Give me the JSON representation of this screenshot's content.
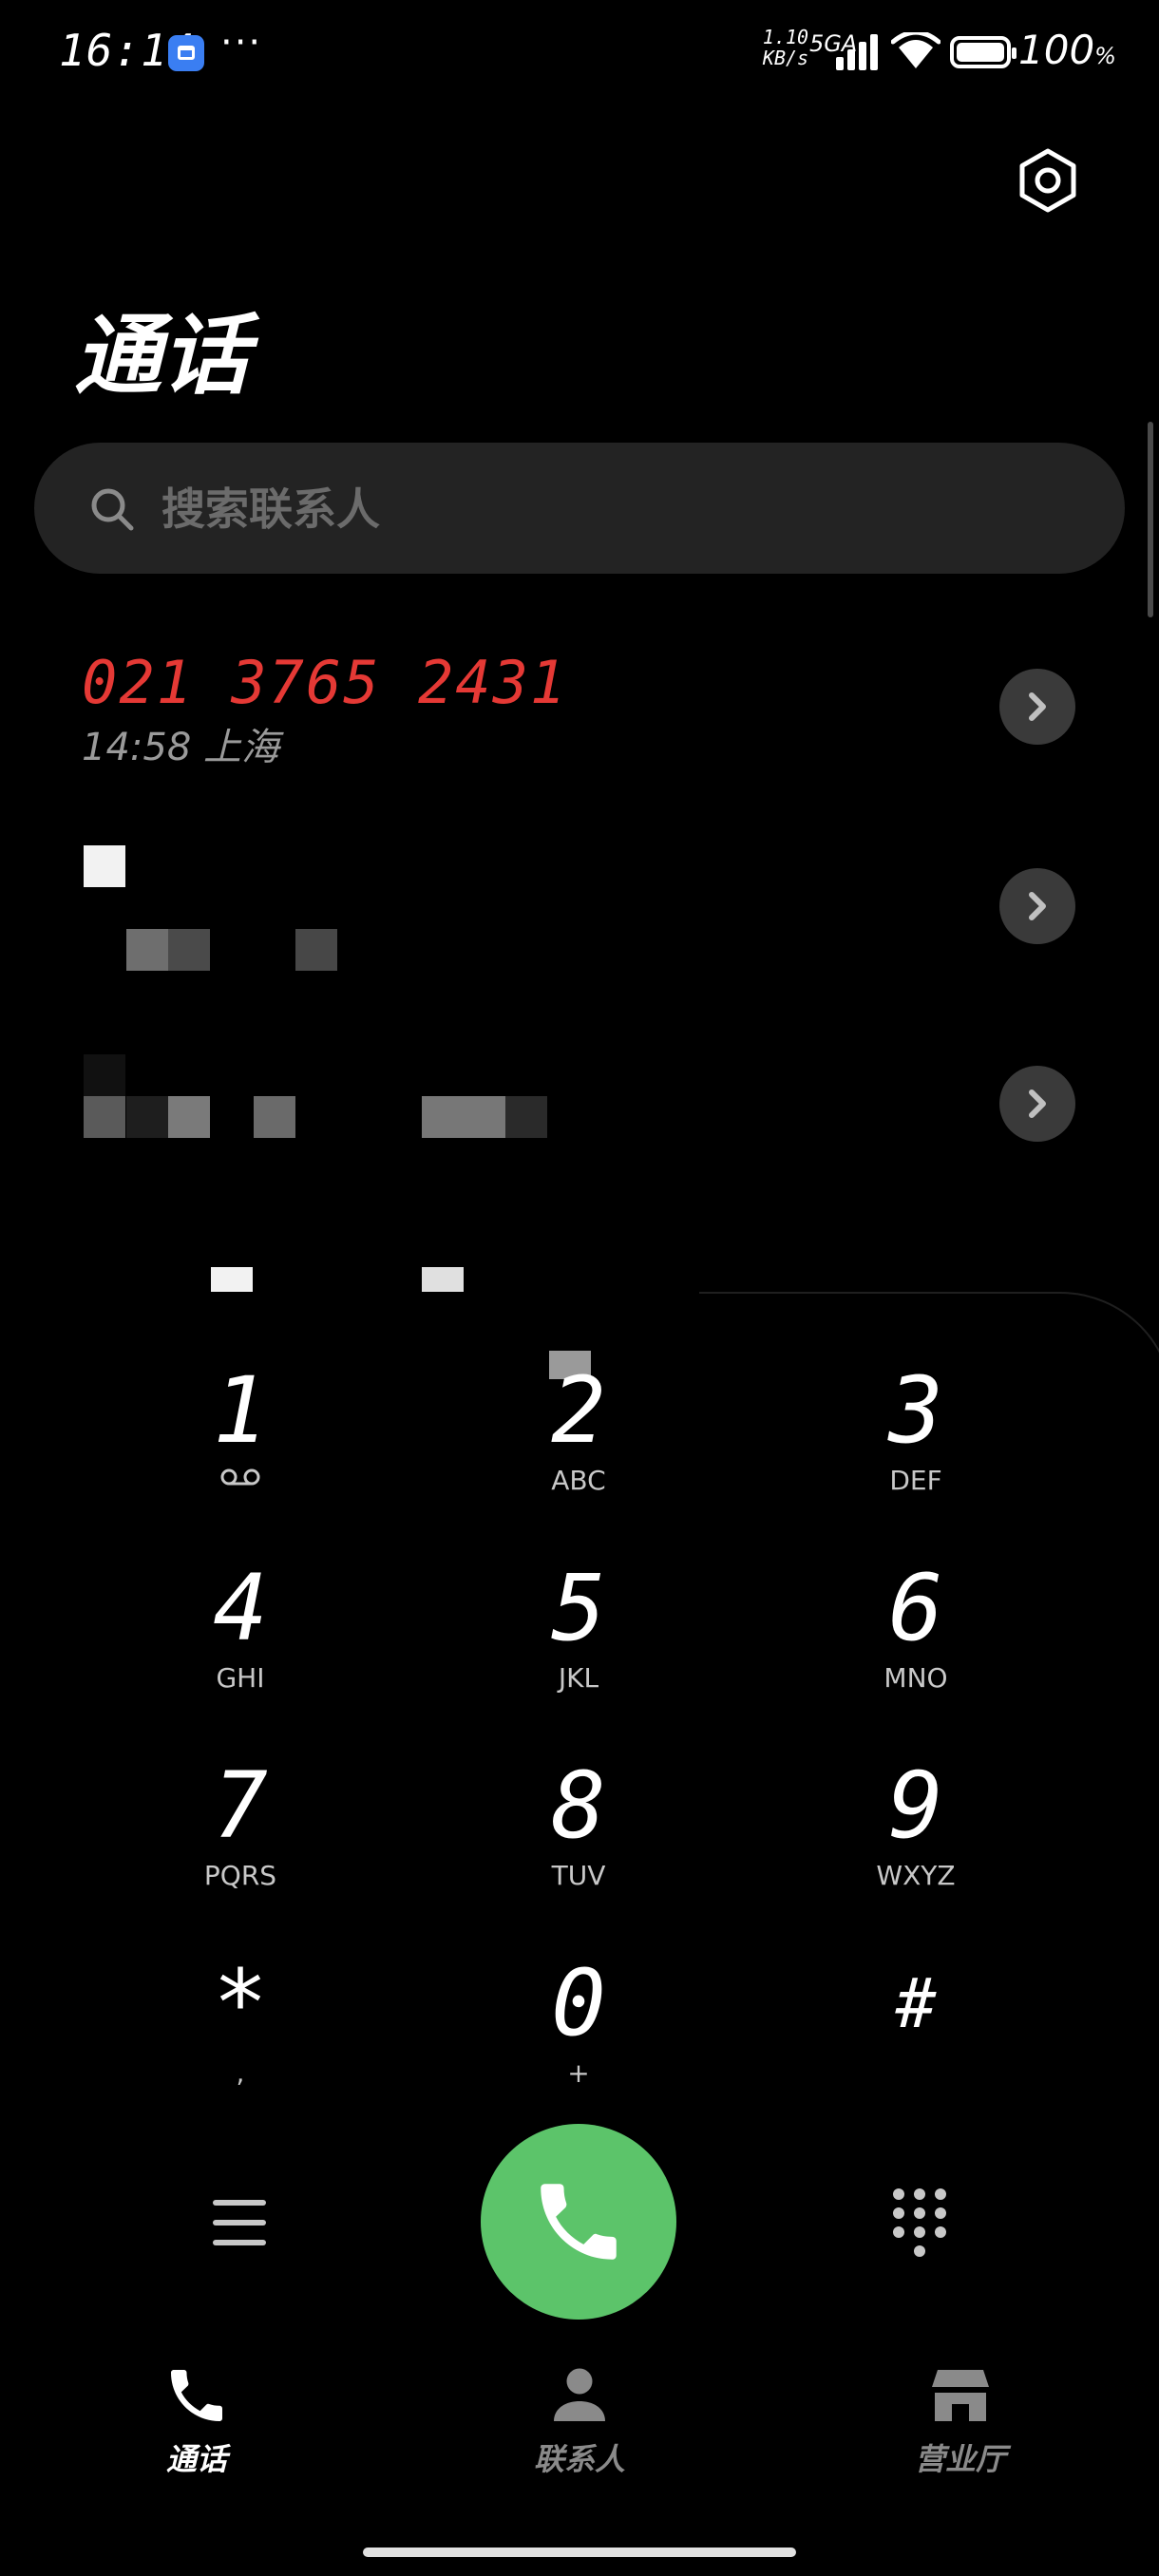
{
  "status_bar": {
    "time": "16:14",
    "dots": "···",
    "speed_value": "1.10",
    "speed_unit": "KB/s",
    "network": "5GA",
    "battery": "100",
    "battery_unit": "%"
  },
  "header": {
    "title": "通话"
  },
  "search": {
    "placeholder": "搜索联系人"
  },
  "calls": [
    {
      "number": "021 3765 2431",
      "time": "14:58",
      "location": "上海",
      "color": "#e53935"
    }
  ],
  "keypad": [
    {
      "digit": "1",
      "letters": "",
      "icon": "voicemail-icon"
    },
    {
      "digit": "2",
      "letters": "ABC"
    },
    {
      "digit": "3",
      "letters": "DEF"
    },
    {
      "digit": "4",
      "letters": "GHI"
    },
    {
      "digit": "5",
      "letters": "JKL"
    },
    {
      "digit": "6",
      "letters": "MNO"
    },
    {
      "digit": "7",
      "letters": "PQRS"
    },
    {
      "digit": "8",
      "letters": "TUV"
    },
    {
      "digit": "9",
      "letters": "WXYZ"
    },
    {
      "digit": "*",
      "letters": ","
    },
    {
      "digit": "0",
      "letters": "+"
    },
    {
      "digit": "#",
      "letters": ""
    }
  ],
  "actions": {
    "call_color": "#5cc46a"
  },
  "nav": {
    "items": [
      {
        "label": "通话",
        "icon": "phone-icon",
        "active": true
      },
      {
        "label": "联系人",
        "icon": "person-icon",
        "active": false
      },
      {
        "label": "营业厅",
        "icon": "store-icon",
        "active": false
      }
    ]
  }
}
